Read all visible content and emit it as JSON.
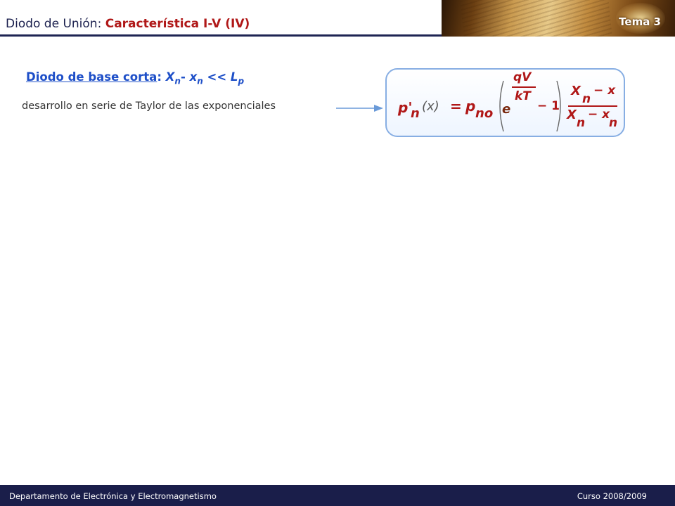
{
  "header": {
    "title_prefix": "Diodo de Unión: ",
    "title_accent": "Característica I-V (IV)",
    "tema": "Tema 3"
  },
  "content": {
    "short_base_label": "Diodo de base corta",
    "short_base_colon": ":",
    "cond_X": "X",
    "cond_X_sub": "n",
    "cond_dash": "-",
    "cond_x": "x",
    "cond_x_sub": "n",
    "cond_lt": "<<",
    "cond_L": "L",
    "cond_L_sub": "p",
    "taylor_text": "desarrollo en serie de Taylor de las exponenciales"
  },
  "formula": {
    "lhs_p": "p'",
    "lhs_sub": "n",
    "lhs_arg": "(x)",
    "equals": "=",
    "p": "p",
    "p_sub": "no",
    "e": "e",
    "exp_num": "qV",
    "exp_den": "kT",
    "minus_one": "− 1",
    "num_X": "X",
    "num_X_sub": "n",
    "num_rest": "− x",
    "den_X": "X",
    "den_X_sub": "n",
    "den_rest": "− x",
    "den_x_sub": "n"
  },
  "footer": {
    "department": "Departamento  de Electrónica  y Electromagnetismo",
    "course": "Curso 2008/2009"
  },
  "colors": {
    "navy": "#1a1e4a",
    "accent_red": "#b01818",
    "link_blue": "#1e4fc8",
    "box_border": "#87aee3"
  }
}
